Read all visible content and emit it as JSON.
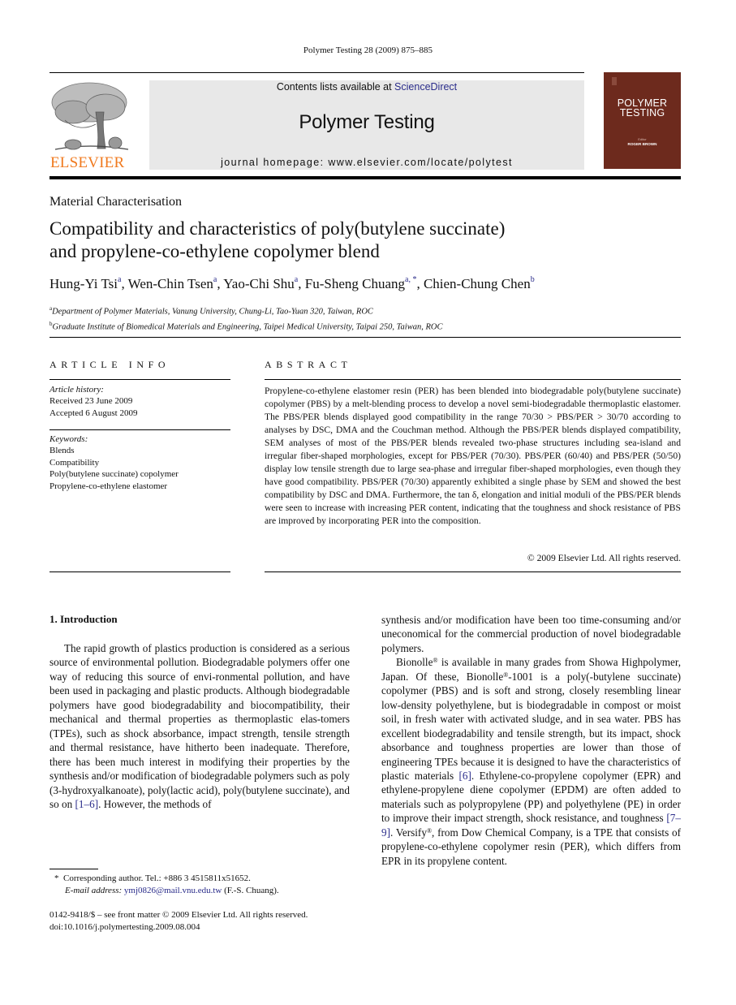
{
  "journal_ref": "Polymer Testing 28 (2009) 875–885",
  "header": {
    "publisher_logo": "elsevier-tree-logo",
    "publisher_name": "ELSEVIER",
    "contents_prefix": "Contents lists available at ",
    "contents_link": "ScienceDirect",
    "journal_title": "Polymer Testing",
    "homepage": "journal homepage: www.elsevier.com/locate/polytest",
    "cover": {
      "title_line1": "POLYMER",
      "title_line2": "TESTING",
      "editor_label": "Editor",
      "editor_name": "ROGER BROWN",
      "color": "#6d2a1d"
    },
    "brand_color": "#f07a1f",
    "link_color": "#2a2c8a"
  },
  "article": {
    "section": "Material Characterisation",
    "title_line1": "Compatibility and characteristics of poly(butylene succinate)",
    "title_line2": "and propylene-co-ethylene copolymer blend",
    "authors": [
      {
        "name": "Hung-Yi Tsi",
        "affil": "a"
      },
      {
        "name": "Wen-Chin Tsen",
        "affil": "a"
      },
      {
        "name": "Yao-Chi Shu",
        "affil": "a"
      },
      {
        "name": "Fu-Sheng Chuang",
        "affil": "a, *"
      },
      {
        "name": "Chien-Chung Chen",
        "affil": "b"
      }
    ],
    "affiliations": [
      {
        "mark": "a",
        "text": "Department of Polymer Materials, Vanung University, Chung-Li, Tao-Yuan 320, Taiwan, ROC"
      },
      {
        "mark": "b",
        "text": "Graduate Institute of Biomedical Materials and Engineering, Taipei Medical University, Taipai 250, Taiwan, ROC"
      }
    ]
  },
  "article_info": {
    "heading": "ARTICLE INFO",
    "history_label": "Article history:",
    "received": "Received 23 June 2009",
    "accepted": "Accepted 6 August 2009",
    "keywords_label": "Keywords:",
    "keywords": [
      "Blends",
      "Compatibility",
      "Poly(butylene succinate) copolymer",
      "Propylene-co-ethylene elastomer"
    ]
  },
  "abstract": {
    "heading": "ABSTRACT",
    "text": "Propylene-co-ethylene elastomer resin (PER) has been blended into biodegradable poly(butylene succinate) copolymer (PBS) by a melt-blending process to develop a novel semi-biodegradable thermoplastic elastomer. The PBS/PER blends displayed good compatibility in the range 70/30 > PBS/PER > 30/70 according to analyses by DSC, DMA and the Couchman method. Although the PBS/PER blends displayed compatibility, SEM analyses of most of the PBS/PER blends revealed two-phase structures including sea-island and irregular fiber-shaped morphologies, except for PBS/PER (70/30). PBS/PER (60/40) and PBS/PER (50/50) display low tensile strength due to large sea-phase and irregular fiber-shaped morphologies, even though they have good compatibility. PBS/PER (70/30) apparently exhibited a single phase by SEM and showed the best compatibility by DSC and DMA. Furthermore, the tan δ, elongation and initial moduli of the PBS/PER blends were seen to increase with increasing PER content, indicating that the toughness and shock resistance of PBS are improved by incorporating PER into the composition.",
    "copyright": "© 2009 Elsevier Ltd. All rights reserved."
  },
  "body": {
    "intro_heading": "1.  Introduction",
    "col1_p1_a": "The rapid growth of plastics production is considered as a serious source of environmental pollution. Biodegradable polymers offer one way of reducing this source of envi-ronmental pollution, and have been used in packaging and plastic products. Although biodegradable polymers have good biodegradability and biocompatibility, their mechanical and thermal properties as thermoplastic elas-tomers (TPEs), such as shock absorbance, impact strength, tensile strength and thermal resistance, have hitherto been inadequate. Therefore, there has been much interest in modifying their properties by the synthesis and/or modification of biodegradable polymers such as poly (3-hydroxyalkanoate), poly(lactic acid), poly(butylene succinate), and so on ",
    "col1_p1_ref": "[1–6]",
    "col1_p1_b": ". However, the methods of",
    "col2_p1": "synthesis and/or modification have been too time-consuming and/or uneconomical for the commercial production of novel biodegradable polymers.",
    "col2_p2_a": "Bionolle",
    "col2_p2_b": " is available in many grades from Showa Highpolymer, Japan. Of these, Bionolle",
    "col2_p2_c": "-1001 is a poly(-butylene succinate) copolymer (PBS) and is soft and strong, closely resembling linear low-density polyethylene, but is biodegradable in compost or moist soil, in fresh water with activated sludge, and in sea water. PBS has excellent biodegradability and tensile strength, but its impact, shock absorbance and toughness properties are lower than those of engineering TPEs because it is designed to have the characteristics of plastic materials ",
    "col2_p2_ref1": "[6]",
    "col2_p2_d": ". Ethylene-co-propylene copolymer (EPR) and ethylene-propylene diene copolymer (EPDM) are often added to materials such as polypropylene (PP) and polyethylene (PE) in order to improve their impact strength, shock resistance, and toughness ",
    "col2_p2_ref2": "[7–9]",
    "col2_p2_e": ". Versify",
    "col2_p2_f": ", from Dow Chemical Company, is a TPE that consists of propylene-co-ethylene copolymer resin (PER), which differs from EPR in its propylene content.",
    "registered": "®"
  },
  "footnote": {
    "star": "*",
    "corresponding": "Corresponding author. Tel.: +886 3 4515811x51652.",
    "email_label": "E-mail address:",
    "email": "ymj0826@mail.vnu.edu.tw",
    "email_suffix": " (F.-S. Chuang)."
  },
  "front_matter": {
    "issn_line": "0142-9418/$ – see front matter © 2009 Elsevier Ltd. All rights reserved.",
    "doi": "doi:10.1016/j.polymertesting.2009.08.004"
  }
}
